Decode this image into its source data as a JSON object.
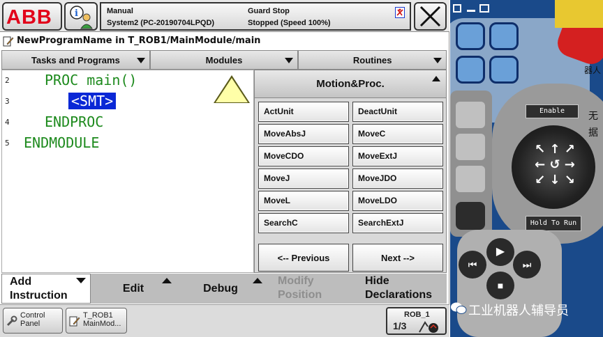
{
  "topbar": {
    "logo": "ABB",
    "status": {
      "mode": "Manual",
      "system": "System2 (PC-20190704LPQD)",
      "guard": "Guard Stop",
      "state": "Stopped (Speed 100%)"
    },
    "close_symbol": "✕"
  },
  "path": "NewProgramName in T_ROB1/MainModule/main",
  "tabs": [
    "Tasks and Programs",
    "Modules",
    "Routines"
  ],
  "code": {
    "line_numbers": [
      "2",
      "3",
      "4",
      "5"
    ],
    "lines": [
      "PROC main()",
      "<SMT>",
      "ENDPROC",
      "ENDMODULE"
    ]
  },
  "panel": {
    "title": "Motion&Proc.",
    "instructions": [
      "ActUnit",
      "DeactUnit",
      "MoveAbsJ",
      "MoveC",
      "MoveCDO",
      "MoveExtJ",
      "MoveJ",
      "MoveJDO",
      "MoveL",
      "MoveLDO",
      "SearchC",
      "SearchExtJ"
    ],
    "previous": "<--  Previous",
    "next": "Next  -->"
  },
  "commands": {
    "add_1": "Add",
    "add_2": "Instruction",
    "edit": "Edit",
    "debug": "Debug",
    "modify_1": "Modify",
    "modify_2": "Position",
    "hide_1": "Hide",
    "hide_2": "Declarations"
  },
  "taskbar": {
    "control_1": "Control",
    "control_2": "Panel",
    "task_1": "T_ROB1",
    "task_2": "MainMod...",
    "rob": "ROB_1",
    "rob_frac": "1/3"
  },
  "flexpendant": {
    "enable": "Enable",
    "hold": "Hold To Run",
    "cjk_1": "无",
    "cjk_2": "据",
    "cjk_3": "器人",
    "watermark": "工业机器人辅导员"
  },
  "colors": {
    "code_green": "#1d8a1d",
    "smt_bg": "#0a28d6",
    "abb_red": "#e2001a"
  },
  "icons": [
    "info-person-icon",
    "guard-stop-icon",
    "close-icon",
    "program-pencil-icon",
    "control-panel-icon",
    "task-icon",
    "robot-speed-icon"
  ]
}
